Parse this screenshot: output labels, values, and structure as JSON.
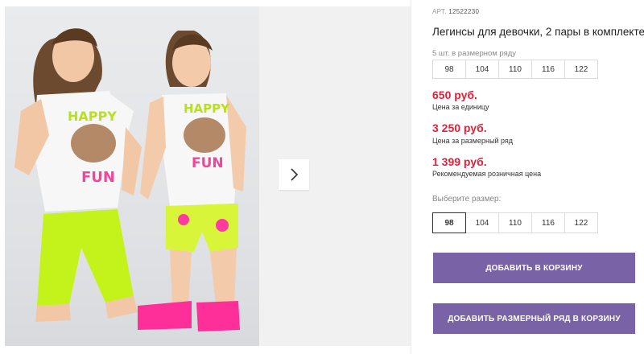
{
  "gallery": {
    "main_photo_alt": "",
    "shirt_text_top": "HAPPY",
    "shirt_text_bottom": "FUN"
  },
  "product": {
    "article_label": "АРТ.",
    "article_number": "12522230",
    "title": "Легинсы для девочки, 2 пары в комплекте",
    "size_row_label": "5 шт. в размерном ряду",
    "size_row": [
      "98",
      "104",
      "110",
      "116",
      "122"
    ],
    "prices": [
      {
        "value": "650 руб.",
        "label": "Цена за единицу"
      },
      {
        "value": "3 250 руб.",
        "label": "Цена за размерный ряд"
      },
      {
        "value": "1 399 руб.",
        "label": "Рекомендуемая розничная цена"
      }
    ],
    "choose_size_label": "Выберите размер:",
    "sizes": [
      "98",
      "104",
      "110",
      "116",
      "122"
    ],
    "selected_size": "98",
    "add_to_cart": "ДОБАВИТЬ В КОРЗИНУ",
    "add_row_to_cart": "ДОБАВИТЬ РАЗМЕРНЫЙ РЯД В КОРЗИНУ"
  },
  "colors": {
    "accent": "#7a62a6",
    "price": "#e3203a"
  }
}
